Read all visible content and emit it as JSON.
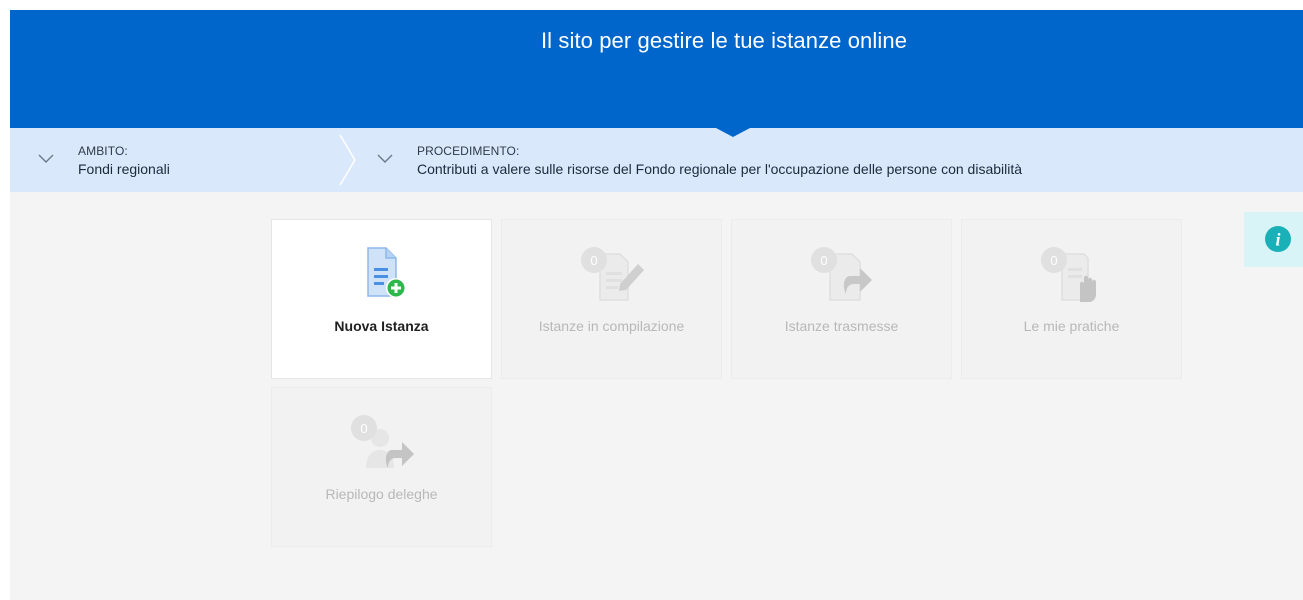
{
  "header": {
    "title": "Il sito per gestire le tue istanze online"
  },
  "breadcrumb": {
    "ambito": {
      "label": "AMBITO:",
      "value": "Fondi regionali"
    },
    "procedimento": {
      "label": "PROCEDIMENTO:",
      "value": "Contributi a valere sulle risorse del Fondo regionale per l'occupazione delle persone con disabilità"
    }
  },
  "tiles": [
    {
      "label": "Nuova Istanza",
      "icon": "new-document-icon",
      "active": true
    },
    {
      "label": "Istanze in compilazione",
      "icon": "edit-document-icon",
      "count": "0"
    },
    {
      "label": "Istanze trasmesse",
      "icon": "forward-document-icon",
      "count": "0"
    },
    {
      "label": "Le mie pratiche",
      "icon": "hand-document-icon",
      "count": "0"
    },
    {
      "label": "Riepilogo deleghe",
      "icon": "delegate-user-icon",
      "count": "0"
    }
  ],
  "info_button": {
    "glyph": "i",
    "icon": "info-icon"
  },
  "colors": {
    "header_blue": "#0066cc",
    "breadcrumb_bg": "#d9e8fb",
    "page_bg": "#f4f4f4",
    "info_accent": "#1ab0b8",
    "new_badge_green": "#2db84b",
    "doc_blue": "#4a90e2"
  }
}
